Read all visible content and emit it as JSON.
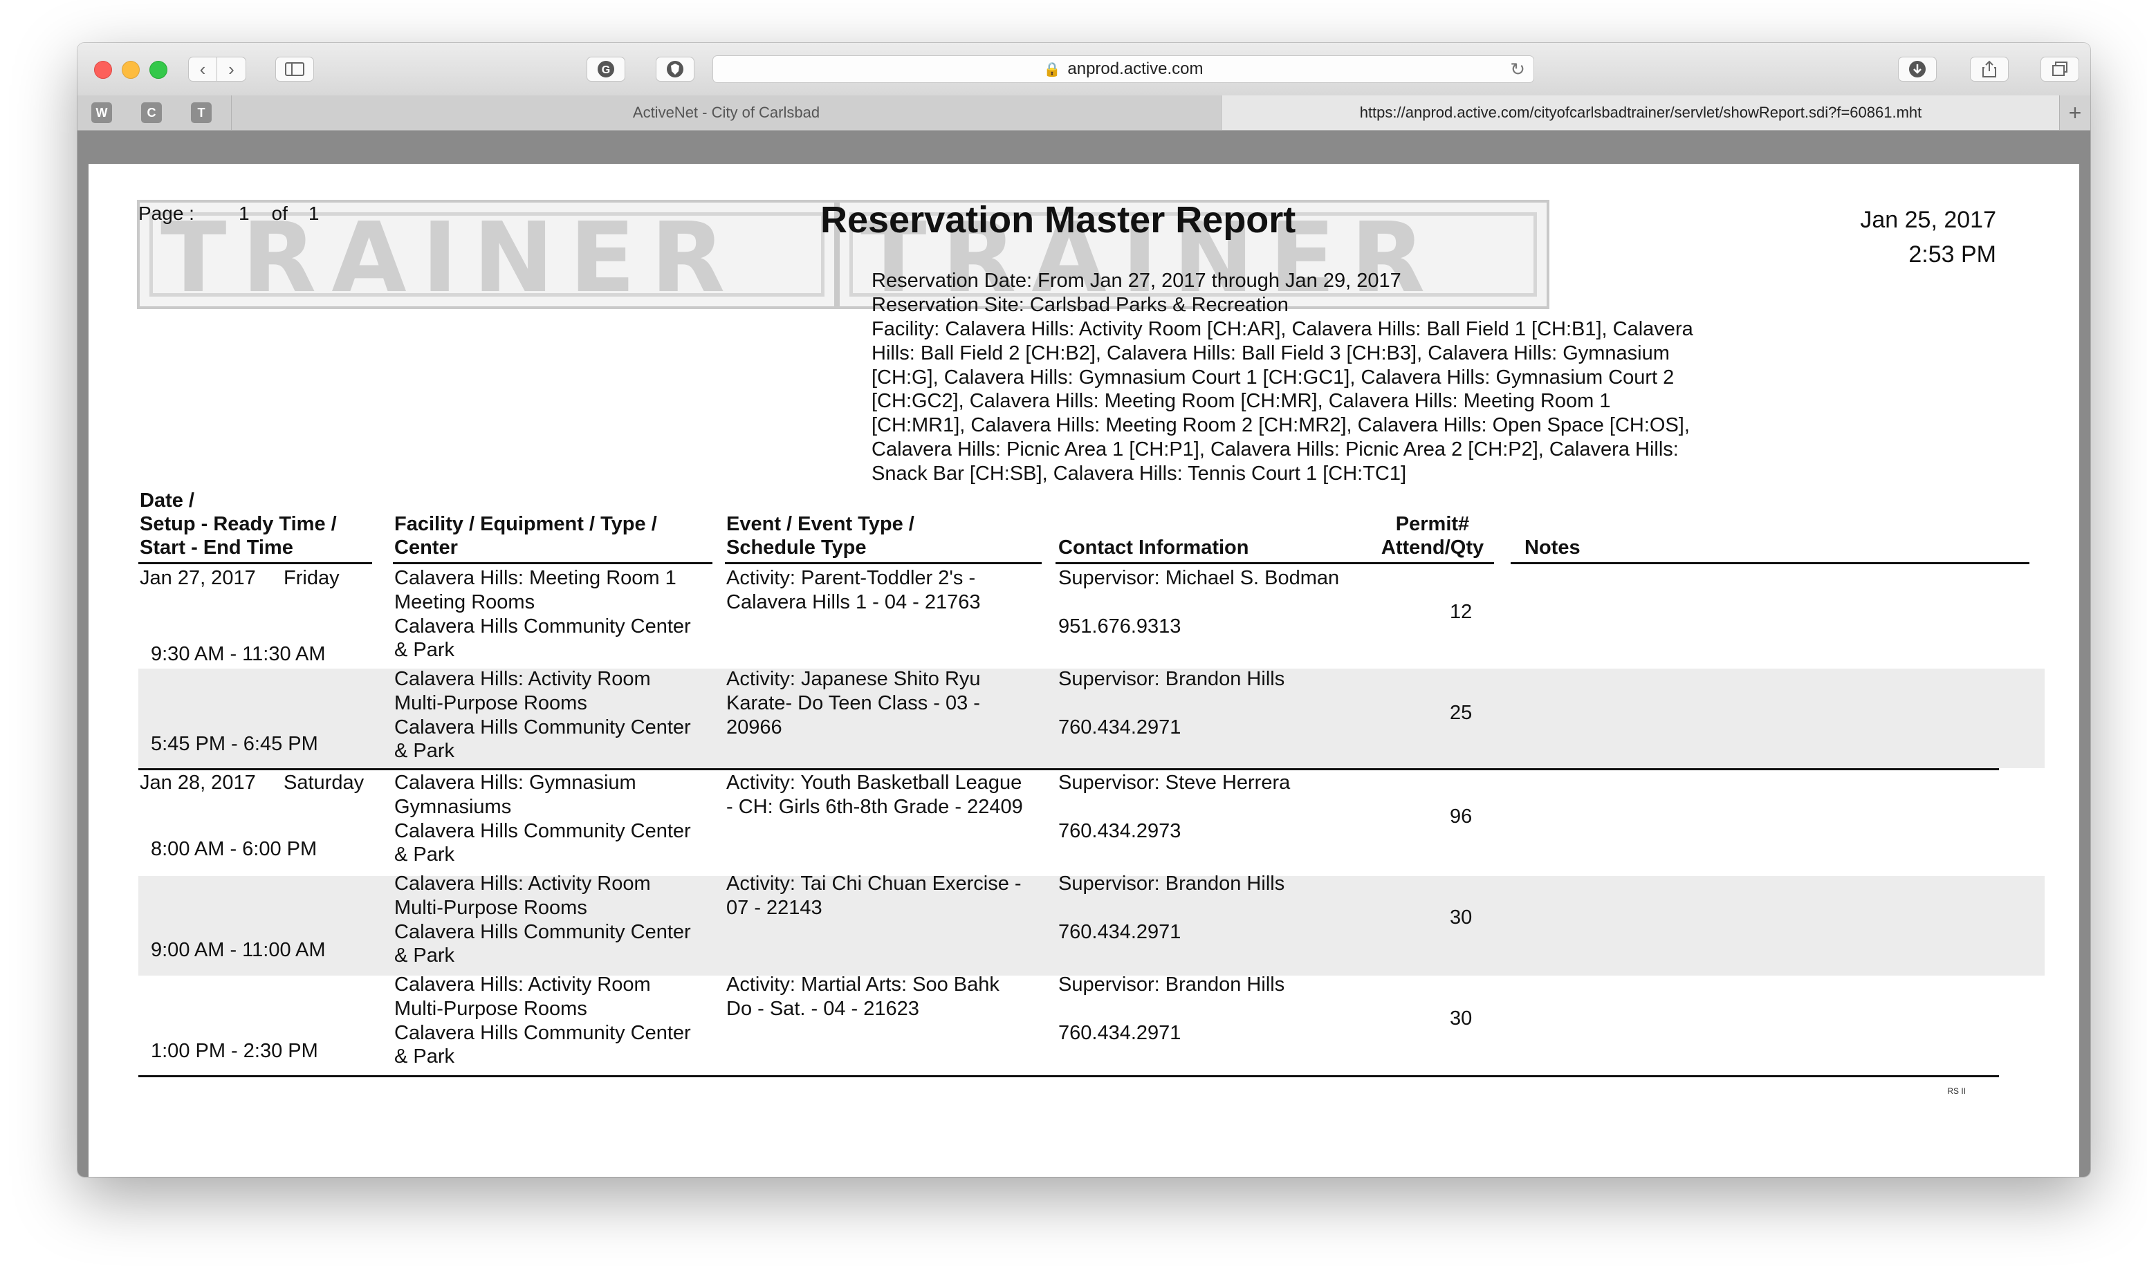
{
  "browser": {
    "url": "anprod.active.com",
    "tabs": [
      {
        "label": "ActiveNet - City of Carlsbad"
      },
      {
        "label": "https://anprod.active.com/cityofcarlsbadtrainer/servlet/showReport.sdi?f=60861.mht"
      }
    ],
    "favorites": [
      "W",
      "C",
      "T"
    ]
  },
  "report": {
    "page_label": "Page :",
    "page_num": "1",
    "of_label": "of",
    "page_total": "1",
    "watermark": "TRAINER",
    "title": "Reservation Master Report",
    "date": "Jan 25, 2017",
    "time": "2:53 PM",
    "reservation_date": "Reservation Date: From Jan 27, 2017   through  Jan 29, 2017",
    "reservation_site": "Reservation Site: Carlsbad Parks & Recreation",
    "facility_lines": [
      "Facility: Calavera Hills: Activity Room [CH:AR], Calavera Hills: Ball Field 1 [CH:B1], Calavera",
      "Hills: Ball Field 2 [CH:B2], Calavera Hills: Ball Field 3 [CH:B3], Calavera Hills: Gymnasium",
      "[CH:G], Calavera Hills: Gymnasium Court 1 [CH:GC1], Calavera Hills: Gymnasium Court 2",
      "[CH:GC2], Calavera Hills: Meeting Room [CH:MR], Calavera Hills: Meeting Room 1",
      "[CH:MR1], Calavera Hills: Meeting Room 2 [CH:MR2], Calavera Hills: Open Space [CH:OS],",
      "Calavera Hills: Picnic Area 1 [CH:P1], Calavera Hills: Picnic Area 2 [CH:P2], Calavera Hills:",
      "Snack Bar [CH:SB], Calavera Hills: Tennis Court 1 [CH:TC1]"
    ],
    "headers": {
      "date": [
        "Date /",
        "Setup - Ready Time /",
        "Start - End Time"
      ],
      "facility": [
        "Facility / Equipment / Type /",
        "Center"
      ],
      "event": [
        "Event / Event Type /",
        "Schedule Type"
      ],
      "contact": [
        "Contact Information"
      ],
      "permit": [
        "Permit#",
        "Attend/Qty"
      ],
      "notes": [
        "Notes"
      ]
    },
    "rows": [
      {
        "date": "Jan 27, 2017",
        "day": "Friday",
        "time": "9:30 AM - 11:30 AM",
        "facility": [
          "Calavera Hills: Meeting Room 1",
          "Meeting Rooms",
          "Calavera Hills Community Center",
          "& Park"
        ],
        "event": [
          "Activity: Parent-Toddler 2's -",
          "Calavera Hills 1 - 04 - 21763"
        ],
        "contact": "Supervisor: Michael  S. Bodman",
        "phone": "951.676.9313",
        "qty": "12"
      },
      {
        "date": "",
        "day": "",
        "time": "5:45 PM - 6:45 PM",
        "facility": [
          "Calavera Hills: Activity Room",
          "Multi-Purpose Rooms",
          "Calavera Hills Community Center",
          "& Park"
        ],
        "event": [
          "Activity: Japanese Shito Ryu",
          "Karate- Do Teen Class - 03 -",
          "20966"
        ],
        "contact": "Supervisor: Brandon  Hills",
        "phone": "760.434.2971",
        "qty": "25"
      },
      {
        "date": "Jan 28, 2017",
        "day": "Saturday",
        "time": "8:00 AM - 6:00 PM",
        "facility": [
          "Calavera Hills: Gymnasium",
          "Gymnasiums",
          "Calavera Hills Community Center",
          "& Park"
        ],
        "event": [
          "Activity: Youth Basketball League",
          "- CH: Girls 6th-8th Grade - 22409"
        ],
        "contact": "Supervisor: Steve  Herrera",
        "phone": "760.434.2973",
        "qty": "96"
      },
      {
        "date": "",
        "day": "",
        "time": "9:00 AM - 11:00 AM",
        "facility": [
          "Calavera Hills: Activity Room",
          "Multi-Purpose Rooms",
          "Calavera Hills Community Center",
          "& Park"
        ],
        "event": [
          "Activity: Tai Chi Chuan Exercise -",
          "07 - 22143"
        ],
        "contact": "Supervisor: Brandon  Hills",
        "phone": "760.434.2971",
        "qty": "30"
      },
      {
        "date": "",
        "day": "",
        "time": "1:00 PM - 2:30 PM",
        "facility": [
          "Calavera Hills: Activity Room",
          "Multi-Purpose Rooms",
          "Calavera Hills Community Center",
          "& Park"
        ],
        "event": [
          "Activity: Martial Arts: Soo Bahk",
          "Do - Sat. - 04 - 21623"
        ],
        "contact": "Supervisor: Brandon  Hills",
        "phone": "760.434.2971",
        "qty": "30"
      }
    ],
    "footer_code": "RS II"
  }
}
